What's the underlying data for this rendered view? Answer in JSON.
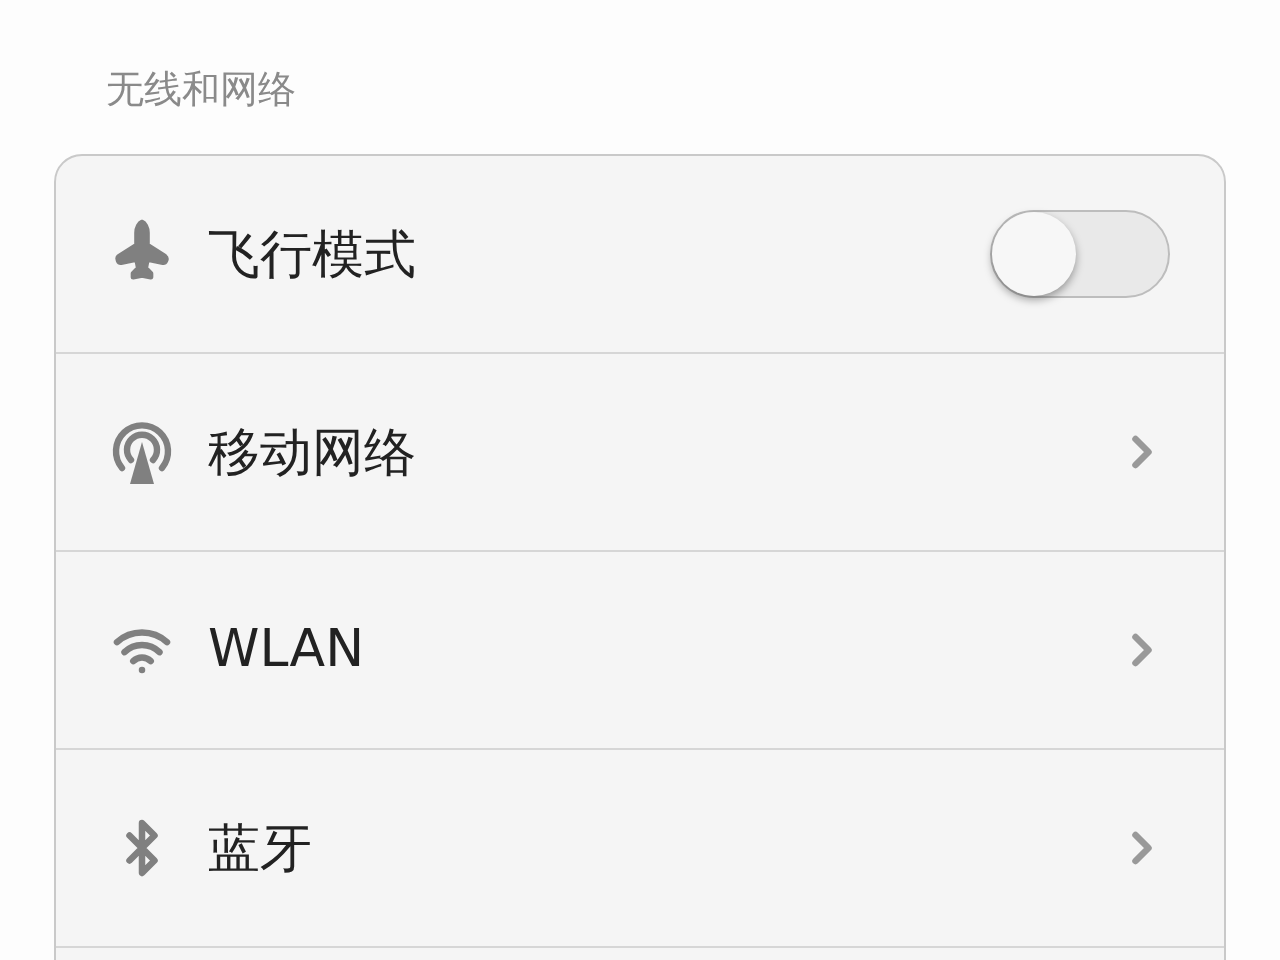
{
  "section_title": "无线和网络",
  "items": [
    {
      "kind": "toggle",
      "label": "飞行模式",
      "on": false
    },
    {
      "kind": "link",
      "label": "移动网络"
    },
    {
      "kind": "link",
      "label": "WLAN"
    },
    {
      "kind": "link",
      "label": "蓝牙"
    }
  ]
}
